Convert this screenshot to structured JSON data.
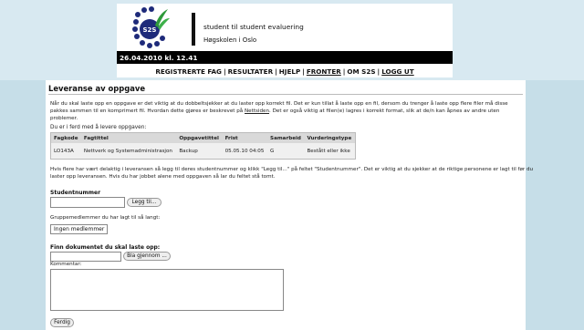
{
  "header": {
    "logo_text": "S2S",
    "site_title": "student til student evaluering",
    "school": "Høgskolen i Oslo",
    "date": "26.04.2010 kl. 12.41",
    "accent_color": "#1e2a7a",
    "leaf_color": "#2e9a3a"
  },
  "nav": {
    "items": [
      "REGISTRERTE FAG",
      "RESULTATER",
      "HJELP",
      "FRONTER",
      "OM S2S",
      "LOGG UT"
    ],
    "separator": "|"
  },
  "page": {
    "title": "Leveranse av oppgave",
    "intro_1": "Når du skal laste opp en oppgave er det viktig at du dobbeltsjekker at du laster opp korrekt fil. Det er kun tillat å laste opp en fil, dersom du trenger å laste opp flere filer må disse pakkes sammen til en komprimert fil. Hvordan dette gjøres er beskrevet på",
    "intro_link": "Nettsiden",
    "intro_2": ". Det er også viktig at filen(e) lagres i korrekt format, slik at de/n kan åpnes av andre uten problemer.",
    "sub": "Du er i ferd med å levere oppgaven:",
    "table": {
      "headers": [
        "Fagkode",
        "Fagtittel",
        "Oppgavetittel",
        "Frist",
        "Samarbeid",
        "Vurderingstype"
      ],
      "rows": [
        [
          "LO143A",
          "Nettverk og Systemadministrasjon",
          "Backup",
          "05.05.10 04:05",
          "G",
          "Bestått eller ikke"
        ]
      ]
    },
    "info": "Hvis flere har vært delaktig i leveransen så legg til deres studentnummer og klikk \"Legg til...\" på feltet \"Studentnummer\". Det er viktig at du sjekker at de riktige personene er lagt til før du laster opp leveransen. Hvis du har jobbet alene med oppgaven så lar du feltet stå tomt.",
    "student_label": "Studentnummer",
    "add_button": "Legg til...",
    "members_label": "Gruppemedlemmer du har lagt til så langt:",
    "members_value": "Ingen medlemmer",
    "file_label": "Finn dokumentet du skal laste opp:",
    "browse_button": "Bla gjennom ...",
    "comment_label": "Kommentar:",
    "comment_value": "",
    "finish_button": "Ferdig"
  }
}
